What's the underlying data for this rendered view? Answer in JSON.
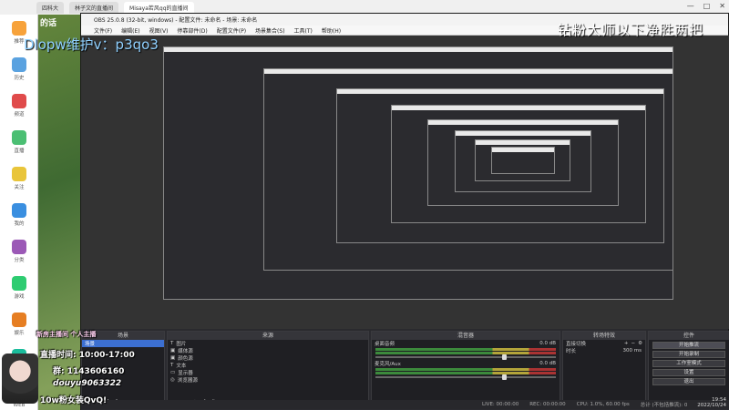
{
  "browser": {
    "tabs": [
      "四科大",
      "林子文的直播间",
      "Misaya若风qq的直播间"
    ],
    "window_controls": [
      "—",
      "□",
      "✕"
    ]
  },
  "left_sidebar": {
    "items": [
      "推荐",
      "历史",
      "频道",
      "直播",
      "关注",
      "我的",
      "分类",
      "游戏",
      "娱乐",
      "视频",
      "WEB"
    ]
  },
  "overlay": {
    "top_right_text": "钻粉大师以下净胜两把",
    "contact_text": "Dlopw维护v：p3qo3",
    "top_left_text": "的话"
  },
  "obs": {
    "title": "OBS 25.0.8 (32-bit, windows) - 配置文件: 未命名 - 场景: 未命名",
    "menu": [
      "文件(F)",
      "编辑(E)",
      "视图(V)",
      "停靠部件(D)",
      "配置文件(P)",
      "场景集合(S)",
      "工具(T)",
      "帮助(H)"
    ],
    "docks": {
      "scenes": {
        "title": "场景",
        "items": [
          "场景"
        ]
      },
      "sources": {
        "title": "来源",
        "items": [
          "图片",
          "媒体源",
          "颜色源",
          "文本",
          "显示器",
          "浏览器源"
        ]
      },
      "mixer": {
        "title": "混音器",
        "channels": [
          {
            "name": "桌面音频",
            "db": "0.0 dB"
          },
          {
            "name": "麦克风/Aux",
            "db": "0.0 dB"
          }
        ]
      },
      "transitions": {
        "title": "转场特效",
        "type": "直接切换",
        "duration_label": "时长",
        "duration": "300 ms"
      },
      "controls": {
        "title": "控件",
        "buttons": [
          "开始推流",
          "开始录制",
          "工作室模式",
          "设置",
          "退出"
        ]
      }
    },
    "status": {
      "live": "LIVE: 00:00:00",
      "rec": "REC: 00:00:00",
      "cpu": "CPU: 1.0%, 60.00 fps",
      "sum": "总计 (不包括推流): 0"
    }
  },
  "widget": {
    "line1": "直播时间: 10:00-17:00",
    "line2": "群: 1143606160",
    "line3": "douyu9063322",
    "line4": "10w粉女装QvQ!",
    "header": "新房主播间 个人主播"
  },
  "clock": {
    "time": "19:54",
    "date": "2022/10/24"
  }
}
